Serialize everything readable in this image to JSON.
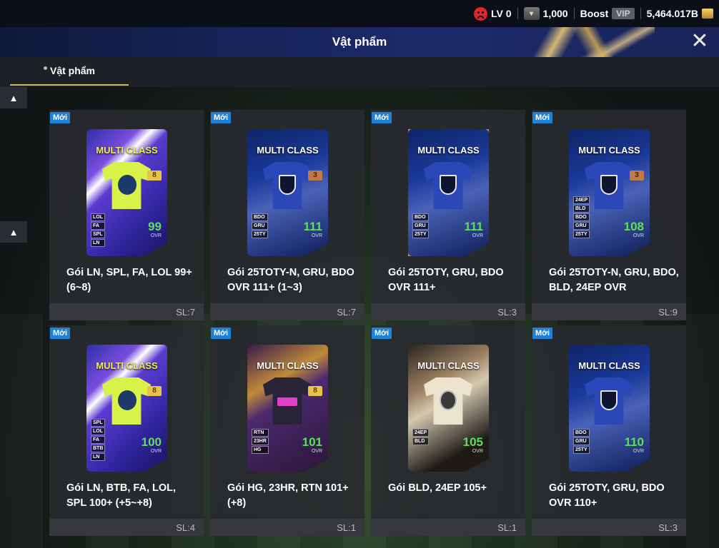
{
  "status": {
    "level": "LV 0",
    "coins": "1,000",
    "boost": "Boost",
    "vip": "VIP",
    "bp": "5,464.017B"
  },
  "header": {
    "title": "Vật phẩm"
  },
  "tabs": [
    {
      "label": "Vật phẩm"
    }
  ],
  "items": [
    {
      "badge": "Mới",
      "pack_title": "MULTI CLASS",
      "num": "8",
      "ovr": "99",
      "ovr_label": "OVR",
      "tags": [
        "LOL",
        "FA",
        "SPL",
        "LN"
      ],
      "name": "Gói LN, SPL, FA, LOL 99+ (6~8)",
      "qty": "SL:7"
    },
    {
      "badge": "Mới",
      "pack_title": "MULTI CLASS",
      "num": "3",
      "ovr": "111",
      "ovr_label": "OVR",
      "tags": [
        "BDO",
        "GRU",
        "25TY"
      ],
      "name": "Gói 25TOTY-N, GRU, BDO OVR 111+ (1~3)",
      "qty": "SL:7"
    },
    {
      "badge": "Mới",
      "pack_title": "MULTI CLASS",
      "num": "",
      "ovr": "111",
      "ovr_label": "OVR",
      "tags": [
        "BDO",
        "GRU",
        "25TY"
      ],
      "name": "Gói 25TOTY, GRU, BDO OVR 111+",
      "qty": "SL:3"
    },
    {
      "badge": "Mới",
      "pack_title": "MULTI CLASS",
      "num": "3",
      "ovr": "108",
      "ovr_label": "OVR",
      "tags": [
        "24EP",
        "BLD",
        "BDO",
        "GRU",
        "25TY"
      ],
      "name": "Gói 25TOTY-N, GRU, BDO, BLD, 24EP OVR",
      "qty": "SL:9"
    },
    {
      "badge": "Mới",
      "pack_title": "MULTI CLASS",
      "num": "8",
      "ovr": "100",
      "ovr_label": "OVR",
      "tags": [
        "SPL",
        "LOL",
        "FA",
        "BTB",
        "LN"
      ],
      "name": "Gói LN, BTB, FA, LOL, SPL 100+ (+5~+8)",
      "qty": "SL:4"
    },
    {
      "badge": "Mới",
      "pack_title": "MULTI CLASS",
      "num": "8",
      "ovr": "101",
      "ovr_label": "OVR",
      "tags": [
        "RTN",
        "23HR",
        "HG"
      ],
      "name": "Gói HG, 23HR, RTN 101+ (+8)",
      "qty": "SL:1"
    },
    {
      "badge": "Mới",
      "pack_title": "MULTI CLASS",
      "num": "",
      "ovr": "105",
      "ovr_label": "OVR",
      "tags": [
        "24EP",
        "BLD"
      ],
      "name": "Gói BLD, 24EP 105+",
      "qty": "SL:1"
    },
    {
      "badge": "Mới",
      "pack_title": "MULTI CLASS",
      "num": "",
      "ovr": "110",
      "ovr_label": "OVR",
      "tags": [
        "BDO",
        "GRU",
        "25TY"
      ],
      "name": "Gói 25TOTY, GRU, BDO OVR 110+",
      "qty": "SL:3"
    }
  ]
}
